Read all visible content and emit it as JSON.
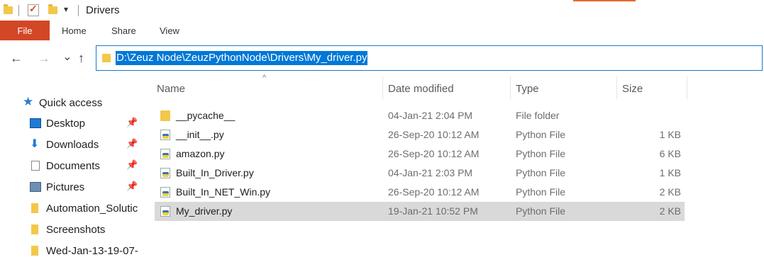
{
  "window": {
    "title": "Drivers"
  },
  "ribbon": {
    "file": "File",
    "tabs": [
      "Home",
      "Share",
      "View"
    ]
  },
  "nav": {
    "back": "←",
    "forward": "→",
    "recent": "⌄",
    "up": "↑",
    "address": "D:\\Zeuz Node\\ZeuzPythonNode\\Drivers\\My_driver.py"
  },
  "sidebar": {
    "quick_access": "Quick access",
    "items": [
      {
        "label": "Desktop",
        "icon": "desktop-icon",
        "pinned": true
      },
      {
        "label": "Downloads",
        "icon": "download-icon",
        "pinned": true
      },
      {
        "label": "Documents",
        "icon": "documents-icon",
        "pinned": true
      },
      {
        "label": "Pictures",
        "icon": "pictures-icon",
        "pinned": true
      },
      {
        "label": "Automation_Solutic",
        "icon": "folder-icon",
        "pinned": false
      },
      {
        "label": "Screenshots",
        "icon": "folder-icon",
        "pinned": false
      },
      {
        "label": "Wed-Jan-13-19-07-",
        "icon": "folder-icon",
        "pinned": false
      }
    ]
  },
  "columns": {
    "name": "Name",
    "date": "Date modified",
    "type": "Type",
    "size": "Size"
  },
  "files": [
    {
      "name": "__pycache__",
      "date": "04-Jan-21 2:04 PM",
      "type": "File folder",
      "size": "",
      "icon": "folder"
    },
    {
      "name": "__init__.py",
      "date": "26-Sep-20 10:12 AM",
      "type": "Python File",
      "size": "1 KB",
      "icon": "python"
    },
    {
      "name": "amazon.py",
      "date": "26-Sep-20 10:12 AM",
      "type": "Python File",
      "size": "6 KB",
      "icon": "python"
    },
    {
      "name": "Built_In_Driver.py",
      "date": "04-Jan-21 2:03 PM",
      "type": "Python File",
      "size": "1 KB",
      "icon": "python"
    },
    {
      "name": "Built_In_NET_Win.py",
      "date": "26-Sep-20 10:12 AM",
      "type": "Python File",
      "size": "2 KB",
      "icon": "python"
    },
    {
      "name": "My_driver.py",
      "date": "19-Jan-21 10:52 PM",
      "type": "Python File",
      "size": "2 KB",
      "icon": "python",
      "selected": true
    }
  ],
  "colors": {
    "file_tab": "#d24726",
    "selection": "#0078d7",
    "row_selected": "#d9d9d9"
  }
}
